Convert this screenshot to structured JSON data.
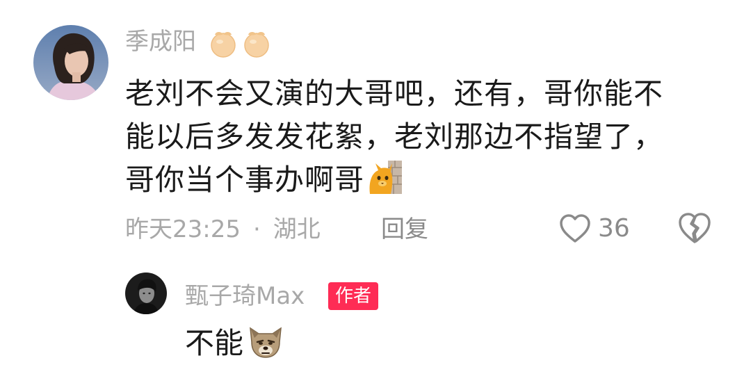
{
  "comment": {
    "username": "季成阳",
    "text_lines": [
      "老刘不会又演的大哥吧，还有，哥你能不",
      "能以后多发发花絮，老刘那边不指望了，",
      "哥你当个事办啊哥"
    ],
    "emoji": "cat-peeking-wall-emoji",
    "badges": [
      "orange-badge-icon",
      "orange-badge-icon"
    ],
    "timestamp": "昨天23:25",
    "separator": "·",
    "location": "湖北",
    "reply_label": "回复",
    "like_count": "36"
  },
  "reply": {
    "username": "甄子琦Max",
    "author_badge": "作者",
    "text": "不能",
    "emoji": "angry-dog-emoji"
  },
  "colors": {
    "meta_gray": "#a8a8a8",
    "text_dark": "#1a1a1a",
    "author_badge_bg": "#fe2c55"
  }
}
